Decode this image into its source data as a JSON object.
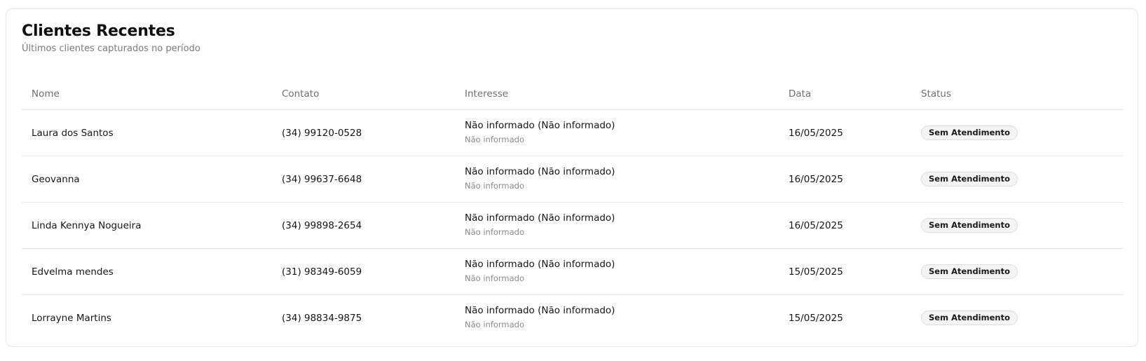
{
  "card": {
    "title": "Clientes Recentes",
    "subtitle": "Últimos clientes capturados no período"
  },
  "table": {
    "columns": [
      "Nome",
      "Contato",
      "Interesse",
      "Data",
      "Status"
    ],
    "rows": [
      {
        "nome": "Laura dos Santos",
        "contato": "(34) 99120-0528",
        "interesse": "Não informado (Não informado)",
        "interesse_sub": "Não informado",
        "data": "16/05/2025",
        "status": "Sem Atendimento"
      },
      {
        "nome": "Geovanna",
        "contato": "(34) 99637-6648",
        "interesse": "Não informado (Não informado)",
        "interesse_sub": "Não informado",
        "data": "16/05/2025",
        "status": "Sem Atendimento"
      },
      {
        "nome": "Linda Kennya Nogueira",
        "contato": "(34) 99898-2654",
        "interesse": "Não informado (Não informado)",
        "interesse_sub": "Não informado",
        "data": "16/05/2025",
        "status": "Sem Atendimento"
      },
      {
        "nome": "Edvelma mendes",
        "contato": "(31) 98349-6059",
        "interesse": "Não informado (Não informado)",
        "interesse_sub": "Não informado",
        "data": "15/05/2025",
        "status": "Sem Atendimento"
      },
      {
        "nome": "Lorrayne Martins",
        "contato": "(34) 98834-9875",
        "interesse": "Não informado (Não informado)",
        "interesse_sub": "Não informado",
        "data": "15/05/2025",
        "status": "Sem Atendimento"
      }
    ]
  },
  "colors": {
    "border": "#e6e6e6",
    "muted_text": "#7a7a7a",
    "badge_bg": "#f4f4f4"
  }
}
